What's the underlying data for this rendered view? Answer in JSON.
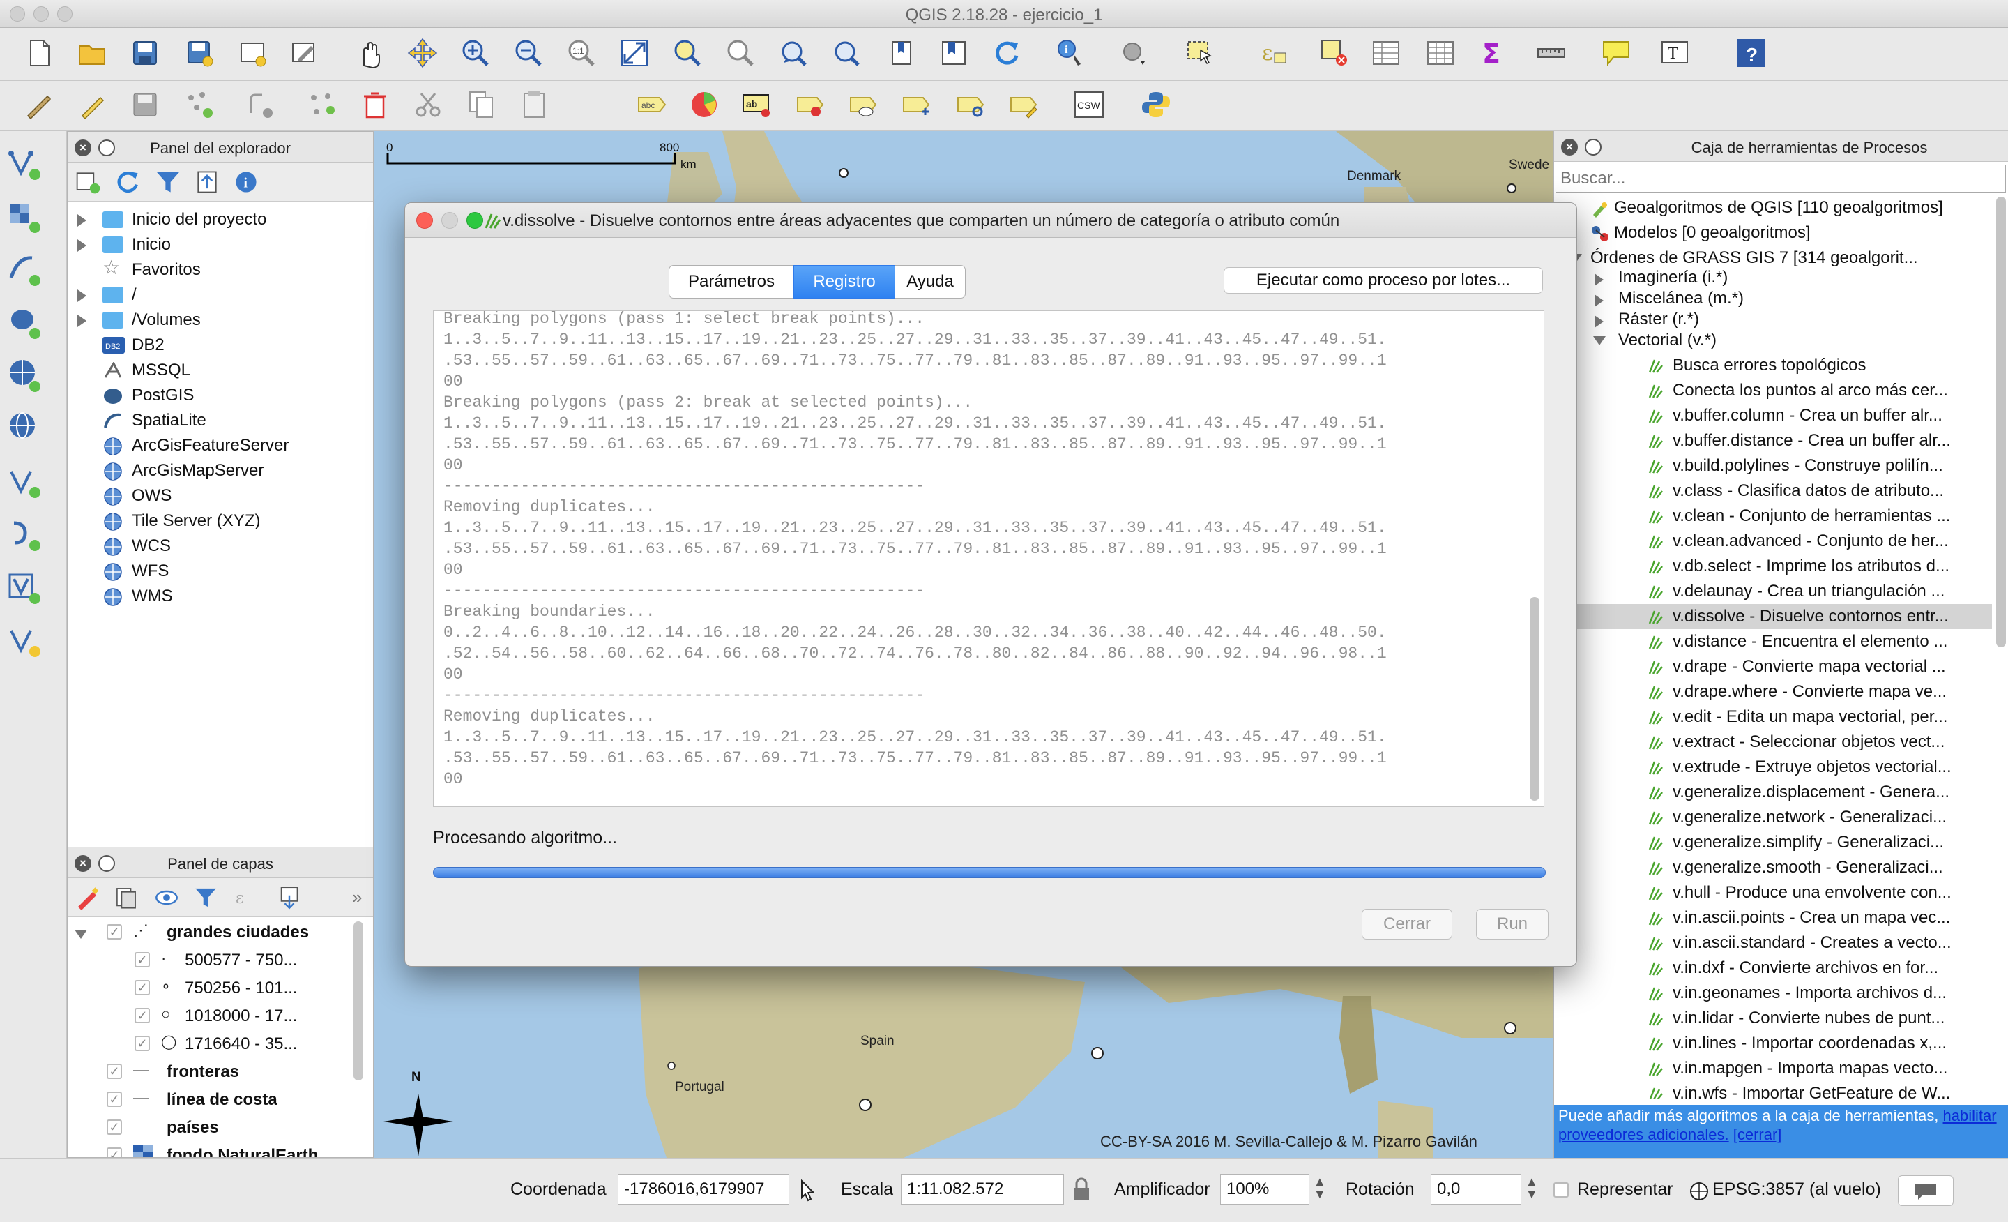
{
  "window": {
    "title": "QGIS 2.18.28 - ejercicio_1"
  },
  "browser": {
    "title": "Panel del explorador",
    "items": [
      {
        "label": "Inicio del proyecto",
        "icon": "folder-icon",
        "expandable": true
      },
      {
        "label": "Inicio",
        "icon": "folder-icon",
        "expandable": true
      },
      {
        "label": "Favoritos",
        "icon": "star-icon",
        "expandable": false
      },
      {
        "label": "/",
        "icon": "folder-icon",
        "expandable": true
      },
      {
        "label": "/Volumes",
        "icon": "folder-icon",
        "expandable": true
      },
      {
        "label": "DB2",
        "icon": "db2-icon",
        "expandable": false
      },
      {
        "label": "MSSQL",
        "icon": "mssql-icon",
        "expandable": false
      },
      {
        "label": "PostGIS",
        "icon": "postgis-icon",
        "expandable": false
      },
      {
        "label": "SpatiaLite",
        "icon": "spatialite-icon",
        "expandable": false
      },
      {
        "label": "ArcGisFeatureServer",
        "icon": "globe-icon",
        "expandable": false
      },
      {
        "label": "ArcGisMapServer",
        "icon": "globe-icon",
        "expandable": false
      },
      {
        "label": "OWS",
        "icon": "globe-icon",
        "expandable": false
      },
      {
        "label": "Tile Server (XYZ)",
        "icon": "globe-icon",
        "expandable": false
      },
      {
        "label": "WCS",
        "icon": "globe-icon",
        "expandable": false
      },
      {
        "label": "WFS",
        "icon": "globe-icon",
        "expandable": false
      },
      {
        "label": "WMS",
        "icon": "globe-icon",
        "expandable": false
      }
    ]
  },
  "layers": {
    "title": "Panel de capas",
    "items": [
      {
        "label": "grandes ciudades",
        "bold": true
      },
      {
        "label": "500577 - 750...",
        "bold": false
      },
      {
        "label": "750256 - 101...",
        "bold": false
      },
      {
        "label": "1018000 - 17...",
        "bold": false
      },
      {
        "label": "1716640 - 35...",
        "bold": false
      },
      {
        "label": "fronteras",
        "bold": true
      },
      {
        "label": "línea de costa",
        "bold": true
      },
      {
        "label": "países",
        "bold": true
      },
      {
        "label": "fondo NaturalEarth",
        "bold": true
      }
    ]
  },
  "map": {
    "scalebar": {
      "start": "0",
      "end": "800",
      "unit": "km"
    },
    "labels": {
      "denmark": "Denmark",
      "sweden": "Swede",
      "spain": "Spain",
      "portugal": "Portugal"
    },
    "north": "N",
    "copyright": "CC-BY-SA 2016 M. Sevilla-Callejo & M. Pizarro Gavilán"
  },
  "dialog": {
    "title": "v.dissolve - Disuelve contornos entre áreas adyacentes que comparten un número de categoría o atributo común",
    "tabs": [
      "Parámetros",
      "Registro",
      "Ayuda"
    ],
    "active_tab": "Registro",
    "batch_button": "Ejecutar como proceso por lotes...",
    "log_lines": [
      "Breaking polygons (pass 1: select break points)...",
      "1..3..5..7..9..11..13..15..17..19..21..23..25..27..29..31..33..35..37..39..41..43..45..47..49..51.",
      ".53..55..57..59..61..63..65..67..69..71..73..75..77..79..81..83..85..87..89..91..93..95..97..99..1",
      "00",
      "Breaking polygons (pass 2: break at selected points)...",
      "1..3..5..7..9..11..13..15..17..19..21..23..25..27..29..31..33..35..37..39..41..43..45..47..49..51.",
      ".53..55..57..59..61..63..65..67..69..71..73..75..77..79..81..83..85..87..89..91..93..95..97..99..1",
      "00",
      "--------------------------------------------------",
      "Removing duplicates...",
      "1..3..5..7..9..11..13..15..17..19..21..23..25..27..29..31..33..35..37..39..41..43..45..47..49..51.",
      ".53..55..57..59..61..63..65..67..69..71..73..75..77..79..81..83..85..87..89..91..93..95..97..99..1",
      "00",
      "--------------------------------------------------",
      "Breaking boundaries...",
      "0..2..4..6..8..10..12..14..16..18..20..22..24..26..28..30..32..34..36..38..40..42..44..46..48..50.",
      ".52..54..56..58..60..62..64..66..68..70..72..74..76..78..80..82..84..86..88..90..92..94..96..98..1",
      "00",
      "--------------------------------------------------",
      "Removing duplicates...",
      "1..3..5..7..9..11..13..15..17..19..21..23..25..27..29..31..33..35..37..39..41..43..45..47..49..51.",
      ".53..55..57..59..61..63..65..67..69..71..73..75..77..79..81..83..85..87..89..91..93..95..97..99..1",
      "00"
    ],
    "status": "Procesando algoritmo...",
    "progress": 1.0,
    "close_button": "Cerrar",
    "run_button": "Run"
  },
  "processing": {
    "title": "Caja de herramientas de Procesos",
    "search_placeholder": "Buscar...",
    "top_items": [
      {
        "label": "Geoalgoritmos de QGIS [110 geoalgoritmos]",
        "icon": "qgis-icon"
      },
      {
        "label": "Modelos [0 geoalgoritmos]",
        "icon": "models-icon"
      },
      {
        "label": "Órdenes de GRASS GIS 7 [314 geoalgorit...",
        "icon": "grass-icon"
      }
    ],
    "groups": [
      "Imaginería (i.*)",
      "Miscelánea (m.*)",
      "Ráster (r.*)",
      "Vectorial (v.*)"
    ],
    "algorithms": [
      "Busca errores topológicos",
      "Conecta los puntos al arco más cer...",
      "v.buffer.column - Crea un buffer alr...",
      "v.buffer.distance - Crea un buffer alr...",
      "v.build.polylines - Construye polilín...",
      "v.class - Clasifica datos de atributo...",
      "v.clean - Conjunto de herramientas ...",
      "v.clean.advanced - Conjunto de her...",
      "v.db.select - Imprime los atributos d...",
      "v.delaunay - Crea un triangulación ...",
      "v.dissolve - Disuelve contornos entr...",
      "v.distance - Encuentra el elemento ...",
      "v.drape - Convierte mapa vectorial ...",
      "v.drape.where - Convierte mapa ve...",
      "v.edit - Edita un mapa vectorial, per...",
      "v.extract - Seleccionar objetos vect...",
      "v.extrude - Extruye objetos vectorial...",
      "v.generalize.displacement - Genera...",
      "v.generalize.network - Generalizaci...",
      "v.generalize.simplify - Generalizaci...",
      "v.generalize.smooth - Generalizaci...",
      "v.hull - Produce una envolvente con...",
      "v.in.ascii.points - Crea un mapa vec...",
      "v.in.ascii.standard - Creates a vecto...",
      "v.in.dxf - Convierte archivos en for...",
      "v.in.geonames - Importa archivos d...",
      "v.in.lidar - Convierte nubes de punt...",
      "v.in.lines - Importar coordenadas x,...",
      "v.in.mapgen - Importa mapas vecto...",
      "v.in.wfs - Importar GetFeature de W..."
    ],
    "selected_index": 10,
    "notice": {
      "text": "Puede añadir más algoritmos a la caja de herramientas,",
      "link": "habilitar proveedores adicionales.",
      "close": "[cerrar]"
    }
  },
  "status": {
    "coord_label": "Coordenada",
    "coord_value": "-1786016,6179907",
    "scale_label": "Escala",
    "scale_value": "1:11.082.572",
    "magnifier_label": "Amplificador",
    "magnifier_value": "100%",
    "rotation_label": "Rotación",
    "rotation_value": "0,0",
    "render_label": "Representar",
    "crs": "EPSG:3857 (al vuelo)"
  },
  "colors": {
    "accent": "#3a8ee5",
    "tab_active": "#2f82f1",
    "map_sea": "#a5c8e6",
    "map_land": "#c9c39a"
  }
}
